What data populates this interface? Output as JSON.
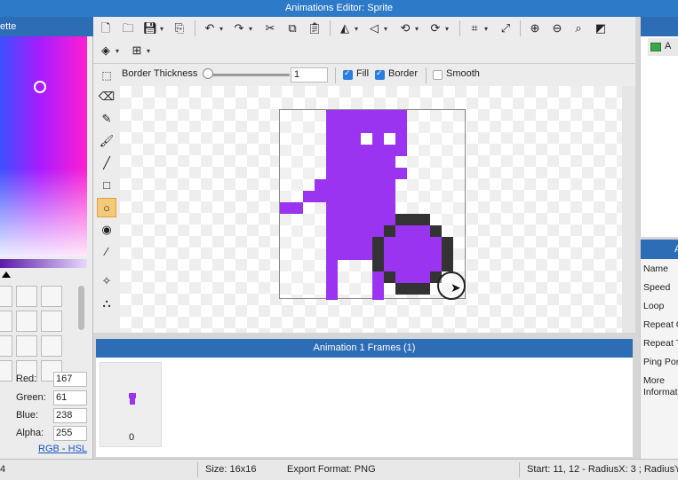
{
  "window": {
    "title": "Animations Editor: Sprite"
  },
  "palette": {
    "title": "ette"
  },
  "color": {
    "red_label": "Red:",
    "red": "167",
    "green_label": "Green:",
    "green": "61",
    "blue_label": "Blue:",
    "blue": "238",
    "alpha_label": "Alpha:",
    "alpha": "255",
    "mode_rgb": "RGB",
    "mode_sep": " - ",
    "mode_hsl": "HSL"
  },
  "options": {
    "border_thickness_label": "Border Thickness",
    "border_thickness_value": "1",
    "fill_label": "Fill",
    "fill_checked": true,
    "border_label": "Border",
    "border_checked": true,
    "smooth_label": "Smooth",
    "smooth_checked": false
  },
  "frames": {
    "header": "Animation 1 Frames (1)",
    "items": [
      {
        "number": "0"
      }
    ]
  },
  "layers": {
    "items": [
      {
        "label": "A"
      }
    ]
  },
  "properties": {
    "header": "A",
    "items": [
      "Name",
      "Speed",
      "Loop",
      "Repeat C",
      "Repeat T",
      "Ping Pon",
      "More",
      "Informat"
    ]
  },
  "status": {
    "left": "4",
    "size": "Size: 16x16",
    "export": "Export Format: PNG",
    "tool_info": "Start: 11, 12 - RadiusX: 3 ; RadiusY"
  },
  "colors": {
    "sprite_purple": "#9b34f0",
    "outline": "#333333",
    "titlebar": "#2d7ac8",
    "panel_header": "#2d6db5"
  }
}
